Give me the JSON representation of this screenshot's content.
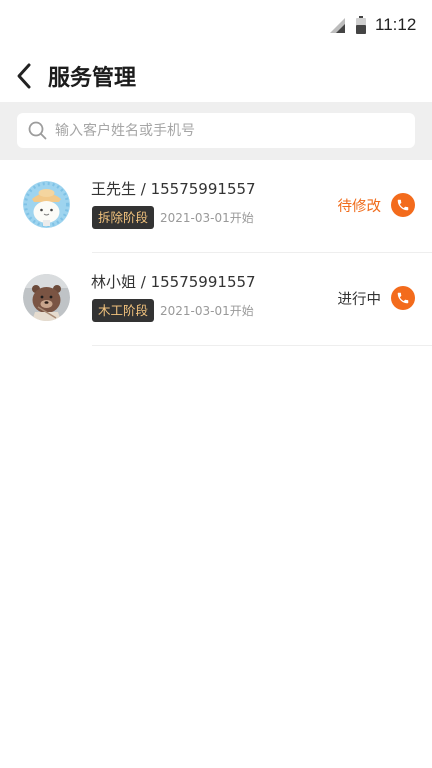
{
  "status_bar": {
    "time": "11:12",
    "signal_icon": "signal-icon",
    "battery_icon": "battery-icon"
  },
  "header": {
    "title": "服务管理",
    "back_icon": "chevron-left-icon"
  },
  "search": {
    "placeholder": "输入客户姓名或手机号",
    "value": "",
    "icon": "search-icon"
  },
  "customers": [
    {
      "name_phone": "王先生 / 15575991557",
      "stage": "拆除阶段",
      "start": "2021-03-01开始",
      "status": "待修改",
      "status_color": "#f06c1c",
      "avatar": "cartoon-cat-avatar"
    },
    {
      "name_phone": "林小姐 / 15575991557",
      "stage": "木工阶段",
      "start": "2021-03-01开始",
      "status": "进行中",
      "status_color": "#333333",
      "avatar": "cartoon-bear-avatar"
    }
  ],
  "colors": {
    "accent": "#f36b1c",
    "badge_bg": "#333333",
    "badge_text": "#f1c27d",
    "search_band": "#efefef"
  }
}
